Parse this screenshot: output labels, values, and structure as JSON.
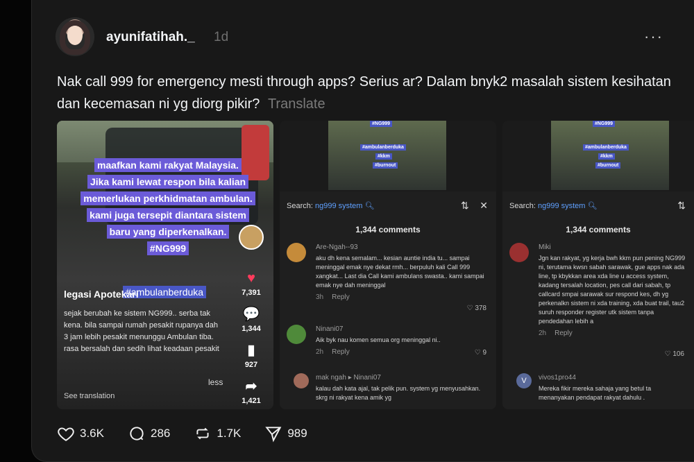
{
  "post": {
    "username": "ayunifatihah._",
    "time": "1d",
    "more": "···",
    "text": "Nak call 999 for emergency mesti through apps? Serius ar? Dalam bnyk2 masalah sistem kesihatan dan kecemasan ni yg diorg pikir?",
    "translate": "Translate"
  },
  "media1": {
    "overlay": [
      "maafkan kami rakyat Malaysia.",
      "Jika kami lewat respon bila kalian",
      "memerlukan perkhidmatan ambulan.",
      "kami juga tersepit diantara sistem",
      "baru yang diperkenalkan.",
      "#NG999"
    ],
    "hashtag": "#ambulanberduka",
    "account": "legasi Apotekari",
    "desc": "sejak berubah ke sistem NG999.. serba tak kena. bila sampai rumah pesakit rupanya dah 3 jam lebih pesakit menunggu Ambulan tiba. rasa bersalah dan sedih lihat keadaan pesakit",
    "less": "less",
    "see_translation": "See translation",
    "likes": "7,391",
    "comments": "1,344",
    "saves": "927",
    "shares": "1,421"
  },
  "media2": {
    "tags": [
      "#NG999",
      "#ambulanberduka",
      "#kkm",
      "#burnout"
    ],
    "search_label": "Search:",
    "search_term": "ng999 system",
    "comments_count": "1,344 comments",
    "comments": [
      {
        "user": "Are-Ngah--93",
        "text": "aku dh kena semalam... kesian auntie india tu... sampai meninggal emak nye dekat rmh... berpuluh kali Call 999 xangkat... Last dia Call kami ambulans swasta.. kami sampai emak nye dah meninggal",
        "time": "3h",
        "reply": "Reply",
        "likes": "378"
      },
      {
        "user": "Ninani07",
        "text": "Aik byk nau komen semua org meninggal ni..",
        "time": "2h",
        "reply": "Reply",
        "likes": "9"
      },
      {
        "user": "mak ngah ▸ Ninani07",
        "text": "kalau dah kata ajal, tak pelik pun. system yg menyusahkan. skrg ni rakyat kena amik yg",
        "time": "",
        "reply": "",
        "likes": ""
      }
    ]
  },
  "media3": {
    "tags": [
      "#NG999",
      "#ambulanberduka",
      "#kkm",
      "#burnout"
    ],
    "search_label": "Search:",
    "search_term": "ng999 system",
    "comments_count": "1,344 comments",
    "comments": [
      {
        "user": "Miki",
        "text": "Jgn kan rakyat, yg kerja bwh kkm pun pening NG999 ni, terutama kwsn sabah sarawak, gue apps nak ada line, tp kbykkan area xda line u access system, kadang tersalah location, pes call dari sabah, tp callcard smpai sarawak sur respond kes, dh yg perkenalkn sistem ni xda training, xda buat trail, tau2 suruh responder register utk sistem tanpa pendedahan lebih a",
        "time": "2h",
        "reply": "Reply",
        "likes": "106"
      },
      {
        "user": "vivos1pro44",
        "text": "Mereka fikir mereka sahaja yang betul ta menanyakan pendapat rakyat dahulu .",
        "time": "",
        "reply": "",
        "likes": ""
      }
    ]
  },
  "actions": {
    "likes": "3.6K",
    "comments": "286",
    "reposts": "1.7K",
    "shares": "989"
  }
}
